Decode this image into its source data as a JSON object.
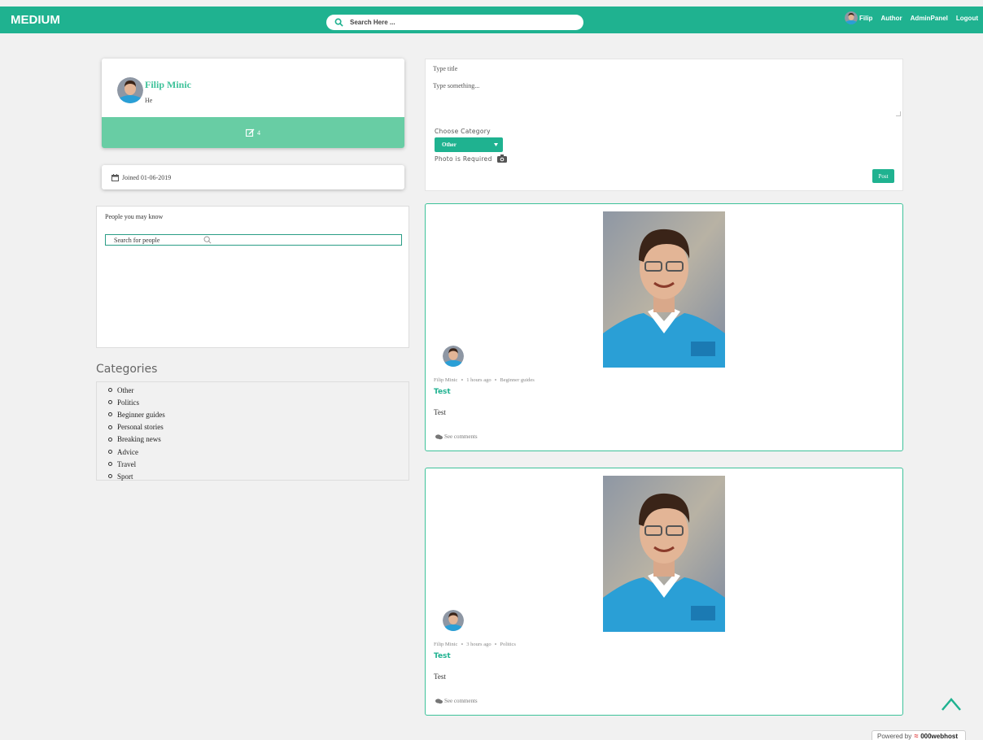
{
  "navbar": {
    "brand": "MEDIUM",
    "search_placeholder": "Search Here ...",
    "user_name": "Filip",
    "links": [
      "Author",
      "AdminPanel",
      "Logout"
    ]
  },
  "profile": {
    "name": "Filip Minic",
    "bio": "He",
    "posts_count": "4",
    "joined": "Joined 01-06-2019"
  },
  "people": {
    "title": "People you may know",
    "search_placeholder": "Search for people"
  },
  "categories": {
    "title": "Categories",
    "items": [
      "Other",
      "Politics",
      "Beginner guides",
      "Personal stories",
      "Breaking news",
      "Advice",
      "Travel",
      "Sport"
    ]
  },
  "composer": {
    "title_placeholder": "Type title",
    "body_placeholder": "Type something...",
    "choose_category_label": "Choose Category",
    "selected_category": "Other",
    "photo_label": "Photo is Required",
    "post_button": "Post"
  },
  "posts": [
    {
      "author": "Filip Minic",
      "time": "1 hours ago",
      "category": "Beginner guides",
      "title": "Test",
      "body": "Test",
      "comments_label": "See comments"
    },
    {
      "author": "Filip Minic",
      "time": "3 hours ago",
      "category": "Politics",
      "title": "Test",
      "body": "Test",
      "comments_label": "See comments"
    }
  ],
  "footer": {
    "powered_by": "Powered by",
    "host_name": "000webhost"
  },
  "colors": {
    "accent": "#1fb290",
    "profile_bar": "#68cda4",
    "background": "#f1f1f1"
  }
}
